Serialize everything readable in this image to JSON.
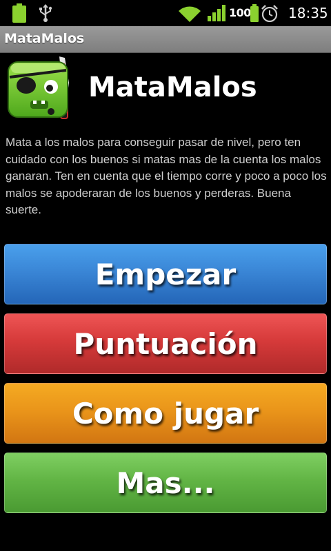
{
  "status_bar": {
    "battery_percent": "100",
    "time": "18:35",
    "icons": [
      "battery-icon",
      "usb-icon",
      "wifi-icon",
      "signal-icon",
      "battery-icon",
      "alarm-icon"
    ]
  },
  "title_bar": {
    "title": "MataMalos"
  },
  "header": {
    "app_name": "MataMalos",
    "logo_icon": "pirate-monster-logo-icon"
  },
  "description": "Mata a los malos para conseguir pasar de nivel, pero ten cuidado con los buenos si matas mas de la cuenta los malos ganaran. Ten en cuenta que el tiempo corre y poco a poco los malos se apoderaran de los buenos y perderas. Buena suerte.",
  "buttons": {
    "start": "Empezar",
    "scores": "Puntuación",
    "how_to_play": "Como jugar",
    "more": "Mas..."
  },
  "colors": {
    "start": "#3a86d6",
    "scores": "#d63a3a",
    "how_to_play": "#ea951a",
    "more": "#62b545"
  }
}
